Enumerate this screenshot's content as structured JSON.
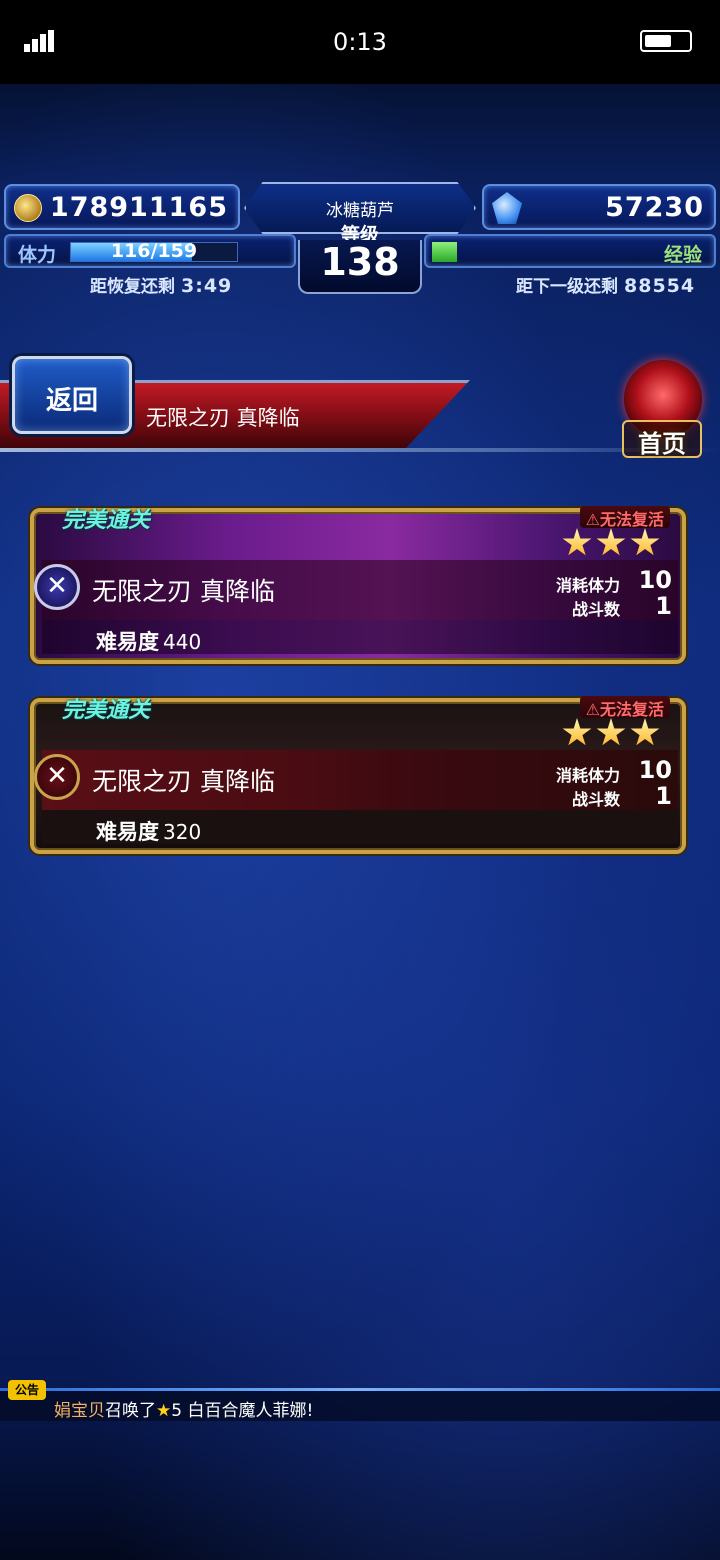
{
  "status_bar": {
    "time": "0:13"
  },
  "hud": {
    "gil": "178911165",
    "gems": "57230",
    "player_name": "冰糖葫芦",
    "level_label": "等级",
    "level": "138",
    "stamina_label": "体力",
    "stamina": "116/159",
    "stamina_fraction": 0.73,
    "recover_label": "距恢复还剩",
    "recover_time": "3:49",
    "exp_label": "经验",
    "exp_fraction": 0.09,
    "next_level_label": "距下一级还剩",
    "next_level_exp": "88554"
  },
  "header": {
    "back_label": "返回",
    "title": "无限之刃 真降临",
    "home_label": "首页"
  },
  "quests": [
    {
      "badge": "完美通关",
      "no_revive": "⚠无法复活",
      "stars": 3,
      "name": "无限之刃 真降临",
      "cost_label": "消耗体力",
      "cost": "10",
      "battles_label": "战斗数",
      "battles": "1",
      "difficulty_label": "难易度",
      "difficulty": "440"
    },
    {
      "badge": "完美通关",
      "no_revive": "⚠无法复活",
      "stars": 3,
      "name": "无限之刃 真降临",
      "cost_label": "消耗体力",
      "cost": "10",
      "battles_label": "战斗数",
      "battles": "1",
      "difficulty_label": "难易度",
      "difficulty": "320"
    }
  ],
  "ticker": {
    "tag": "公告",
    "who": "娟宝贝",
    "action": "召唤了",
    "star": "★",
    "rest": "5 白百合魔人菲娜!"
  },
  "colors": {
    "perfect": "#6ef2e0",
    "warning": "#ff6a6a",
    "gold_frame": "#c9a24a"
  }
}
